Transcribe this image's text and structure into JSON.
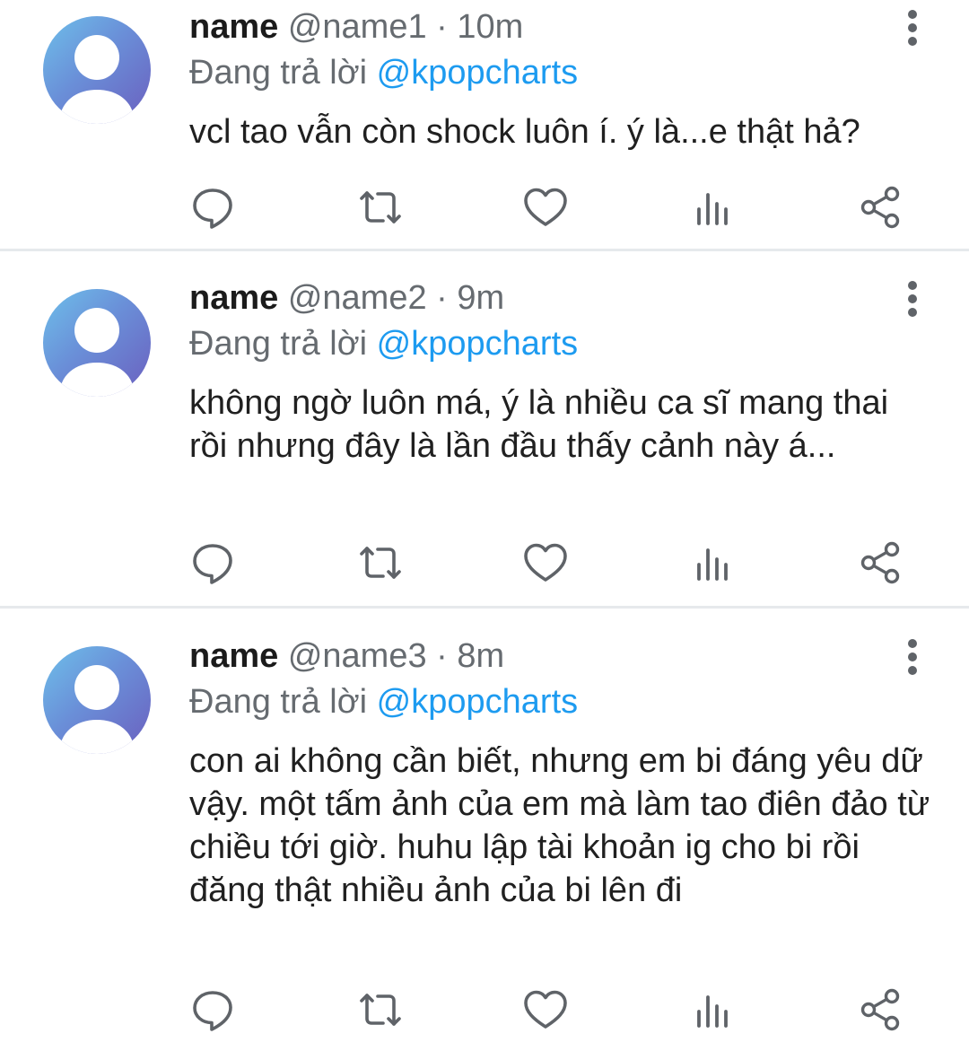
{
  "tweets": [
    {
      "name": "name",
      "handle": "@name1",
      "separator": "·",
      "time": "10m",
      "reply_prefix": "Đang trả lời",
      "reply_to": "@kpopcharts",
      "text": "vcl tao vẫn còn shock luôn í. ý là...e thật hả?"
    },
    {
      "name": "name",
      "handle": "@name2",
      "separator": "·",
      "time": "9m",
      "reply_prefix": "Đang trả lời",
      "reply_to": "@kpopcharts",
      "text": "không ngờ luôn má, ý là nhiều ca sĩ mang thai rồi nhưng đây là lần đầu thấy cảnh này á..."
    },
    {
      "name": "name",
      "handle": "@name3",
      "separator": "·",
      "time": "8m",
      "reply_prefix": "Đang trả lời",
      "reply_to": "@kpopcharts",
      "text": "con ai không cần biết, nhưng em bi đáng yêu dữ vậy. một tấm ảnh của em mà làm tao điên đảo từ chiều tới giờ. huhu lập tài khoản ig cho bi rồi đăng thật nhiều ảnh của bi lên đi"
    }
  ],
  "icons": {
    "reply": "comment-icon",
    "retweet": "retweet-icon",
    "like": "heart-icon",
    "stats": "analytics-icon",
    "share": "share-icon",
    "more": "more-vertical-icon"
  },
  "colors": {
    "mention": "#1d9bf0",
    "secondary_text": "#666b70",
    "icon": "#5f6368",
    "divider": "#e6e9ec"
  }
}
